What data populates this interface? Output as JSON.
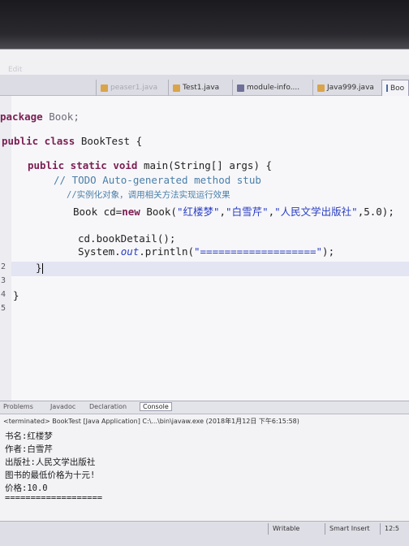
{
  "window": {
    "ghost_title": "Edit"
  },
  "tabs": [
    {
      "label": "peaser1.java",
      "icon": "java-file-icon",
      "faint": true
    },
    {
      "label": "Test1.java",
      "icon": "java-file-icon",
      "faint": false
    },
    {
      "label": "module-info....",
      "icon": "module-file-icon",
      "faint": false
    },
    {
      "label": "Java999.java",
      "icon": "java-file-icon",
      "faint": false
    },
    {
      "label": "Boo",
      "icon": "java-file-icon",
      "faint": false,
      "active": true
    }
  ],
  "editor": {
    "line_numbers": [
      "2",
      "3",
      "4",
      "5"
    ],
    "lines": {
      "package": [
        "package",
        " Book;"
      ],
      "class": [
        "public class",
        " BookTest {"
      ],
      "main": [
        "public static void",
        " main(String[] args) {"
      ],
      "todo": [
        "// TODO Auto-generated method stub"
      ],
      "comment_cn": [
        "//实例化对象，调用相关方法实现运行效果"
      ],
      "new_book": [
        "Book cd=",
        "new",
        " Book(",
        "\"红楼梦\"",
        ",",
        "\"白雪芹\"",
        ",",
        "\"人民文学出版社\"",
        ",5.0);"
      ],
      "detail": [
        "cd.bookDetail();"
      ],
      "println": [
        "System.",
        "out",
        ".println(",
        "\"===================\"",
        ");"
      ],
      "close_method": [
        "}"
      ],
      "close_class": [
        "}"
      ]
    }
  },
  "console": {
    "tabs": [
      "Problems",
      "Javadoc",
      "Declaration",
      "Console"
    ],
    "terminated": "<terminated> BookTest [Java Application] C:\\...\\bin\\javaw.exe (2018年1月12日 下午6:15:58)",
    "output": [
      "书名:红楼梦",
      "作者:白雪芹",
      "出版社:人民文学出版社",
      "图书的最低价格为十元!",
      "价格:10.0",
      "==================="
    ]
  },
  "status_bar": {
    "writable": "Writable",
    "mode": "Smart Insert",
    "position": "12:5"
  },
  "colors": {
    "keyword": "#7b1f53",
    "comment": "#4a7fa8",
    "string": "#2a3ec1"
  }
}
